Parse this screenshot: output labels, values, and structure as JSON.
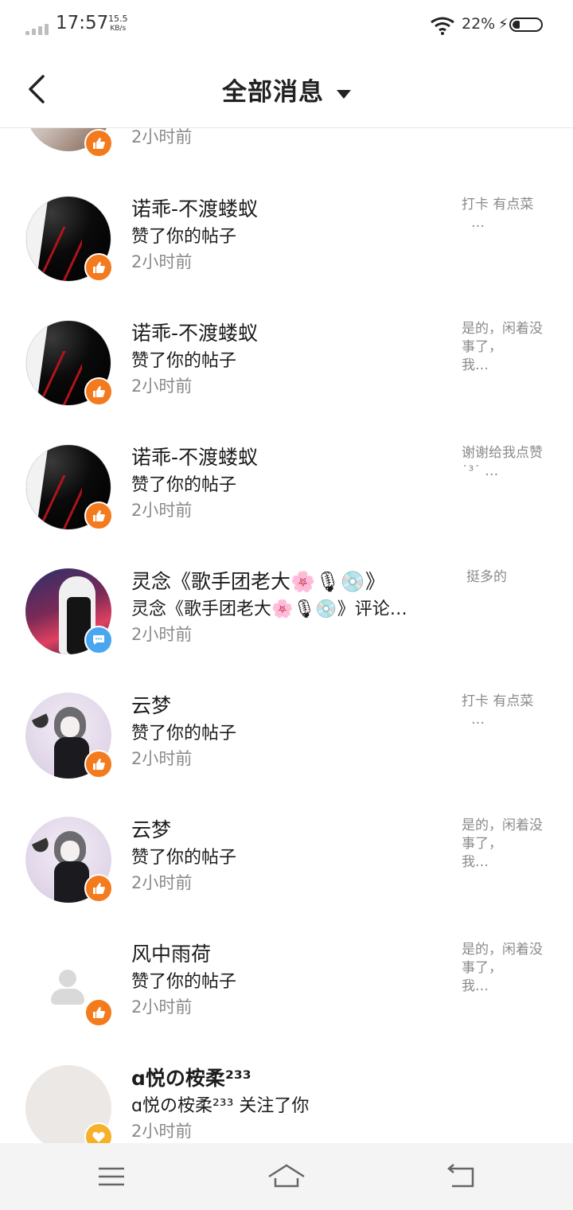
{
  "status_bar": {
    "time": "17:57",
    "net_speed_value": "15.5",
    "net_speed_unit": "KB/s",
    "battery_percent": "22%"
  },
  "header": {
    "title": "全部消息",
    "back_icon": "chevron-left-icon",
    "dropdown_icon": "caret-down-icon"
  },
  "messages": [
    {
      "name": "",
      "action": "",
      "time": "2小时前",
      "ref": "",
      "badge": "like"
    },
    {
      "name": "诺乖-不渡蝼蚁",
      "action": "赞了你的帖子",
      "time": "2小时前",
      "ref": "打卡 有点菜",
      "ref_more": "…",
      "badge": "like"
    },
    {
      "name": "诺乖-不渡蝼蚁",
      "action": "赞了你的帖子",
      "time": "2小时前",
      "ref": "是的，闲着没事了，",
      "ref_more": "我…",
      "badge": "like"
    },
    {
      "name": "诺乖-不渡蝼蚁",
      "action": "赞了你的帖子",
      "time": "2小时前",
      "ref": "谢谢给我点赞˙³˙",
      "ref_more": "…",
      "badge": "like"
    },
    {
      "name": "灵念《歌手团老大🌸🎙💿》",
      "action": "灵念《歌手团老大🌸🎙💿》评论…",
      "time": "2小时前",
      "ref": "挺多的",
      "ref_more": "",
      "badge": "comment"
    },
    {
      "name": "云梦",
      "action": "赞了你的帖子",
      "time": "2小时前",
      "ref": "打卡 有点菜",
      "ref_more": "…",
      "badge": "like"
    },
    {
      "name": "云梦",
      "action": "赞了你的帖子",
      "time": "2小时前",
      "ref": "是的，闲着没事了，",
      "ref_more": "我…",
      "badge": "like"
    },
    {
      "name": "风中雨荷",
      "action": "赞了你的帖子",
      "time": "2小时前",
      "ref": "是的，闲着没事了，",
      "ref_more": "我…",
      "badge": "like"
    },
    {
      "name": "ɑ悦の桉柔²³³",
      "action": "ɑ悦の桉柔²³³ 关注了你",
      "time": "2小时前",
      "ref": "",
      "ref_more": "",
      "badge": "follow"
    }
  ],
  "colors": {
    "like_badge": "#f47a1e",
    "comment_badge": "#4aa6f0",
    "follow_badge": "#f6b12b"
  },
  "navbar": {
    "menu_icon": "menu-icon",
    "home_icon": "home-icon",
    "back_icon": "back-arrow-icon"
  }
}
